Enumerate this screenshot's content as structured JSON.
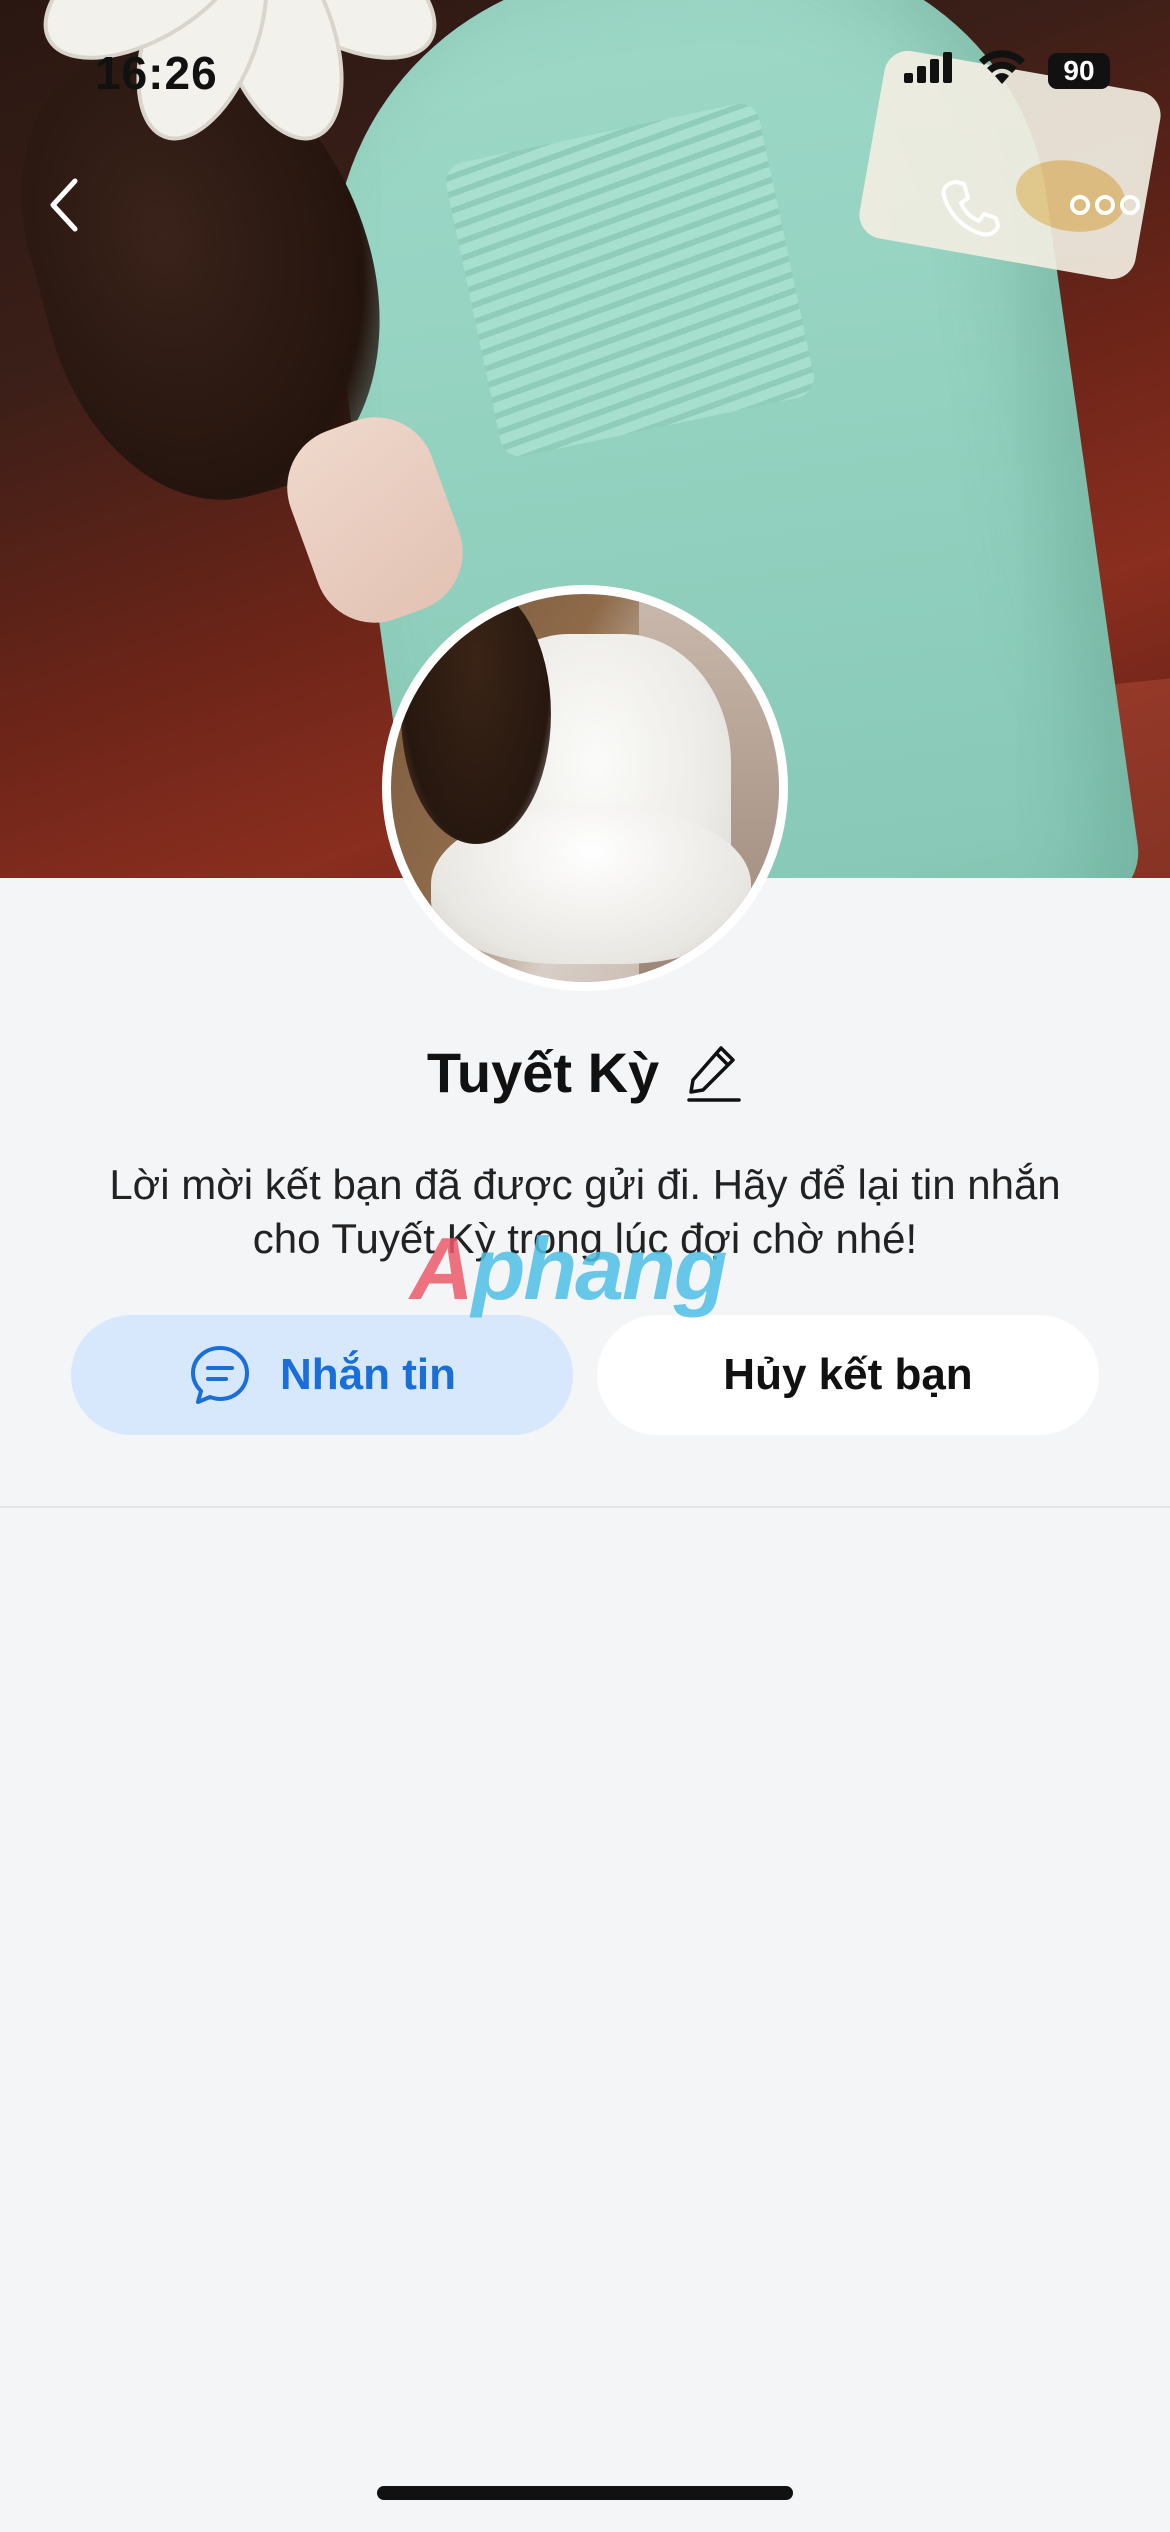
{
  "status_bar": {
    "time": "16:26",
    "battery": "90",
    "signal_icon": "cellular-signal-icon",
    "wifi_icon": "wifi-icon"
  },
  "nav": {
    "back_icon": "chevron-left-icon",
    "call_icon": "phone-icon",
    "more_icon": "more-dots-icon"
  },
  "profile": {
    "name": "Tuyết Kỳ",
    "edit_icon": "pencil-icon",
    "invite_message_line1": "Lời mời kết bạn đã được gửi đi. Hãy để lại tin nhắn",
    "invite_message_line2": "cho Tuyết Kỳ trong lúc đợi chờ nhé!"
  },
  "actions": {
    "message_label": "Nhắn tin",
    "message_icon": "chat-bubble-icon",
    "cancel_label": "Hủy kết bạn"
  },
  "watermark": {
    "first": "A",
    "rest": "phang"
  },
  "colors": {
    "accent": "#1a6ed8",
    "message_button_bg": "#d8e8fc",
    "page_bg": "#f4f5f7"
  }
}
